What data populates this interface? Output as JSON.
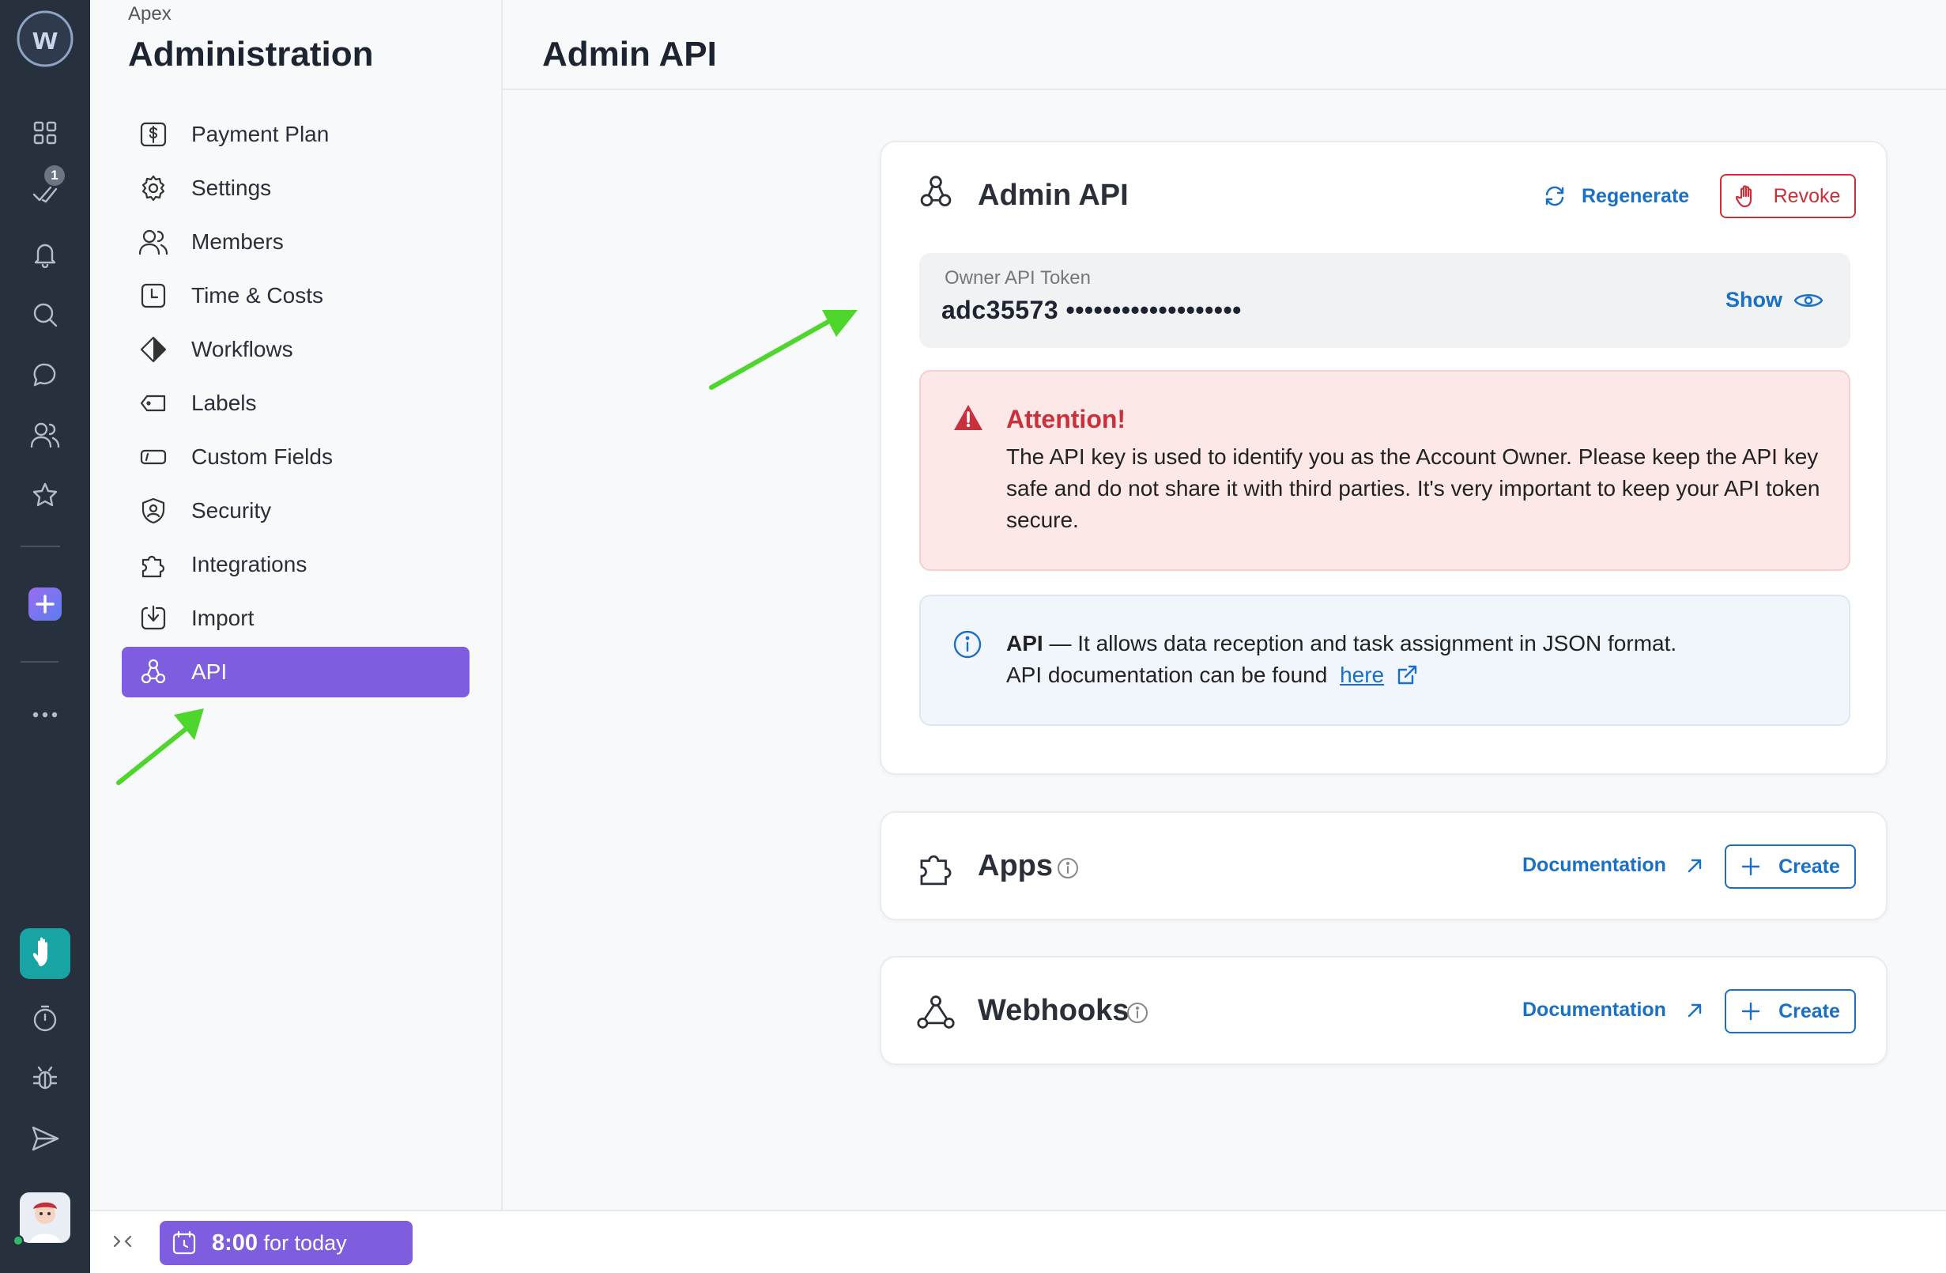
{
  "rail": {
    "logo_letter": "w",
    "tasks_badge": "1",
    "icons": [
      "apps-grid-icon",
      "tasks-check-icon",
      "bell-icon",
      "search-icon",
      "chat-icon",
      "people-icon",
      "star-icon",
      "add-icon",
      "more-icon",
      "wave-hand-icon",
      "timer-icon",
      "bug-icon",
      "send-icon",
      "user-avatar"
    ]
  },
  "sidebar": {
    "org": "Apex",
    "title": "Administration",
    "items": [
      {
        "label": "Payment Plan",
        "icon": "dollar-icon"
      },
      {
        "label": "Settings",
        "icon": "gear-icon"
      },
      {
        "label": "Members",
        "icon": "members-icon"
      },
      {
        "label": "Time & Costs",
        "icon": "clock-icon"
      },
      {
        "label": "Workflows",
        "icon": "workflow-icon"
      },
      {
        "label": "Labels",
        "icon": "label-icon"
      },
      {
        "label": "Custom Fields",
        "icon": "field-icon"
      },
      {
        "label": "Security",
        "icon": "shield-icon"
      },
      {
        "label": "Integrations",
        "icon": "puzzle-icon"
      },
      {
        "label": "Import",
        "icon": "import-icon"
      },
      {
        "label": "API",
        "icon": "api-icon",
        "active": true
      }
    ]
  },
  "header": {
    "title": "Admin API"
  },
  "admin_card": {
    "title": "Admin API",
    "regenerate": "Regenerate",
    "revoke": "Revoke",
    "token_label": "Owner API Token",
    "token_value": "adc35573 •••••••••••••••••••",
    "show": "Show",
    "alert_title": "Attention!",
    "alert_text": "The API key is used to identify you as the Account Owner. Please keep the API key safe and do not share it with third parties. It's very important to keep your API token secure.",
    "info_bold": "API",
    "info_line1": " — It allows data reception and task assignment in JSON format.",
    "info_line2": "API documentation can be found ",
    "info_link": "here"
  },
  "apps_card": {
    "title": "Apps",
    "documentation": "Documentation",
    "create": "Create"
  },
  "webhooks_card": {
    "title": "Webhooks",
    "documentation": "Documentation",
    "create": "Create"
  },
  "footer": {
    "timer_value": "8:00",
    "timer_suffix": " for today"
  },
  "colors": {
    "accent": "#7e5ddf",
    "link": "#1a6fc6",
    "danger": "#c9303a",
    "rail": "#27303d",
    "annotation_arrow": "#4ed62c"
  }
}
